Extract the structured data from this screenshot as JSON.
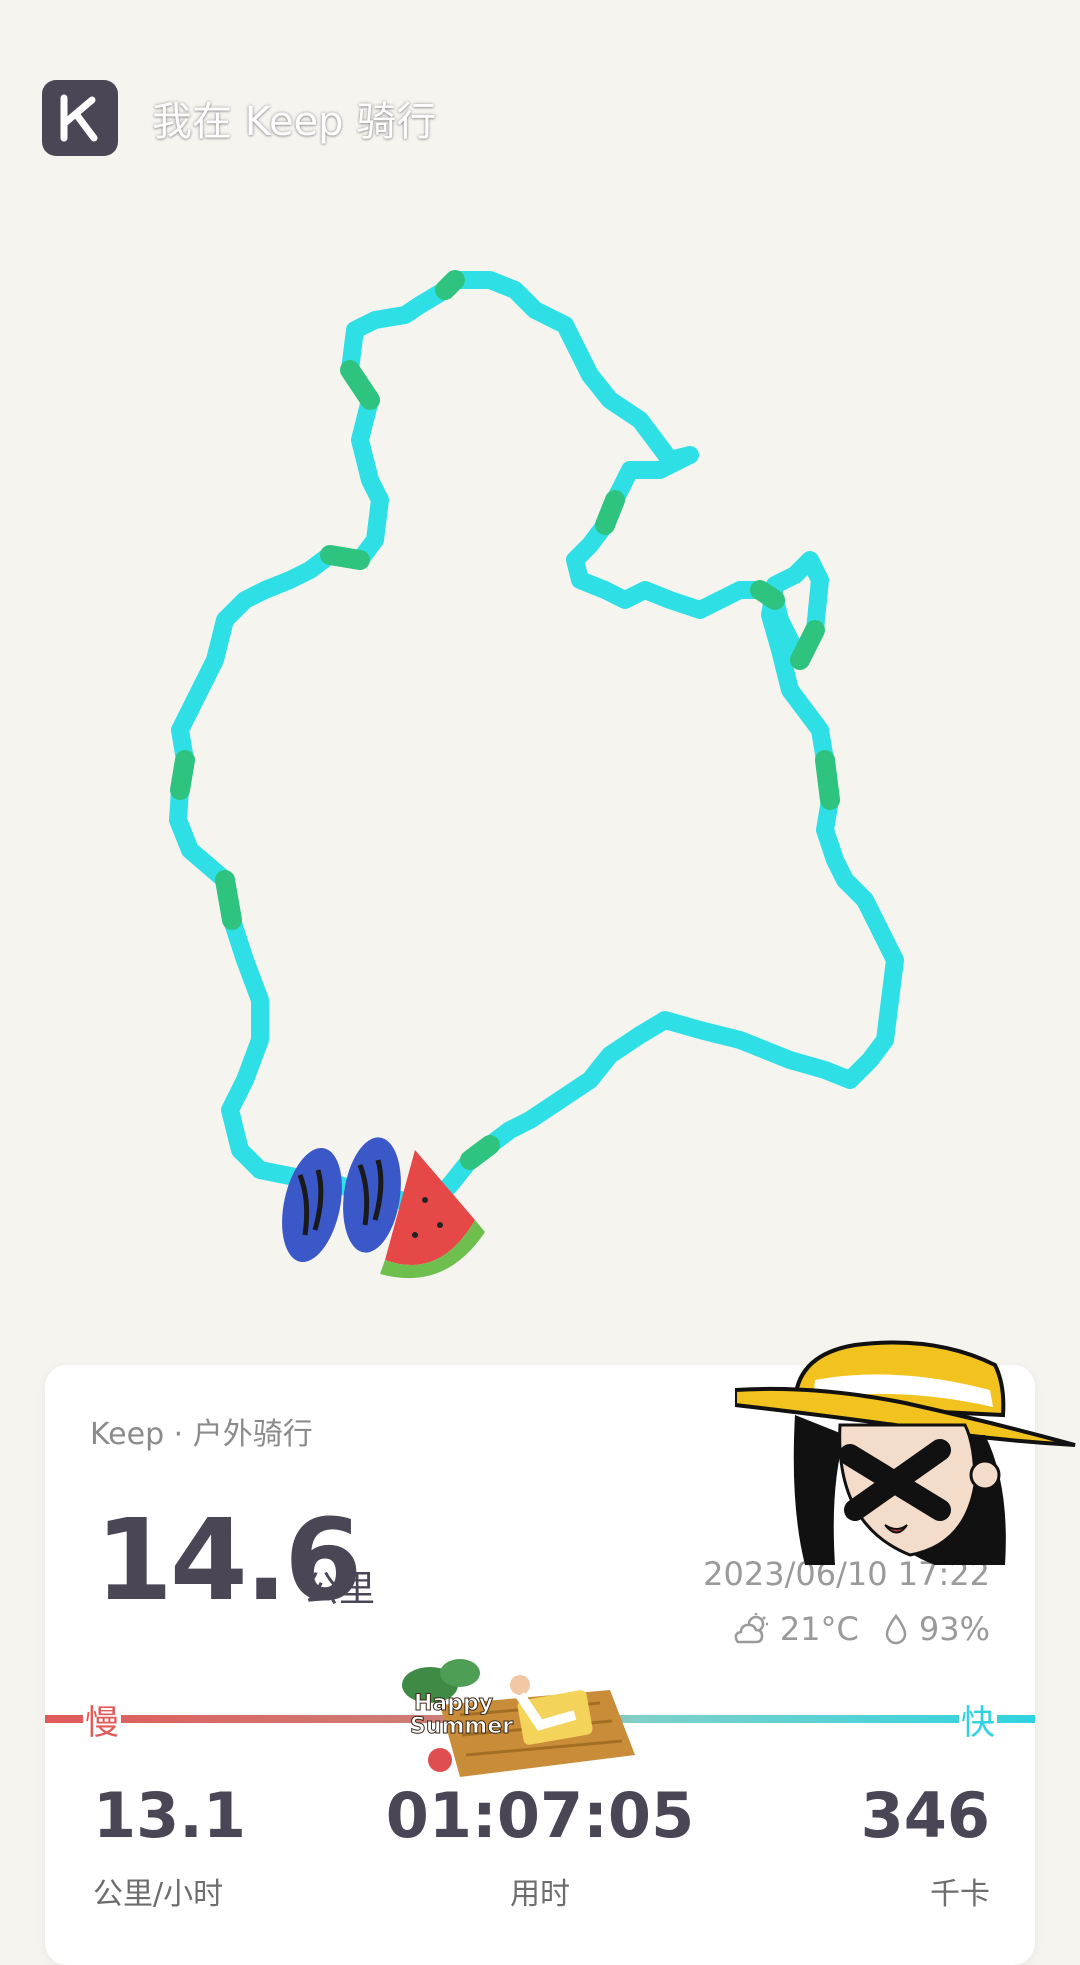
{
  "header": {
    "title": "我在 Keep 骑行",
    "logo_icon": "keep-logo-icon"
  },
  "card": {
    "source": "Keep · 户外骑行",
    "distance": "14.6",
    "distance_unit": "公里",
    "datetime": "2023/06/10 17:22",
    "weather": {
      "temperature": "21°C",
      "humidity": "93%",
      "weather_icon": "partly-cloudy-icon",
      "humidity_icon": "droplet-icon"
    },
    "speed": {
      "slow_label": "慢",
      "fast_label": "快",
      "slow_color": "#e05a5a",
      "fast_color": "#2fd3e0"
    },
    "stats": [
      {
        "value": "13.1",
        "label": "公里/小时"
      },
      {
        "value": "01:07:05",
        "label": "用时"
      },
      {
        "value": "346",
        "label": "千卡"
      }
    ],
    "sticker_text": [
      "Happy",
      "Summer"
    ]
  },
  "route": {
    "color": "#2ee0e6",
    "accent": "#2ec47f"
  }
}
